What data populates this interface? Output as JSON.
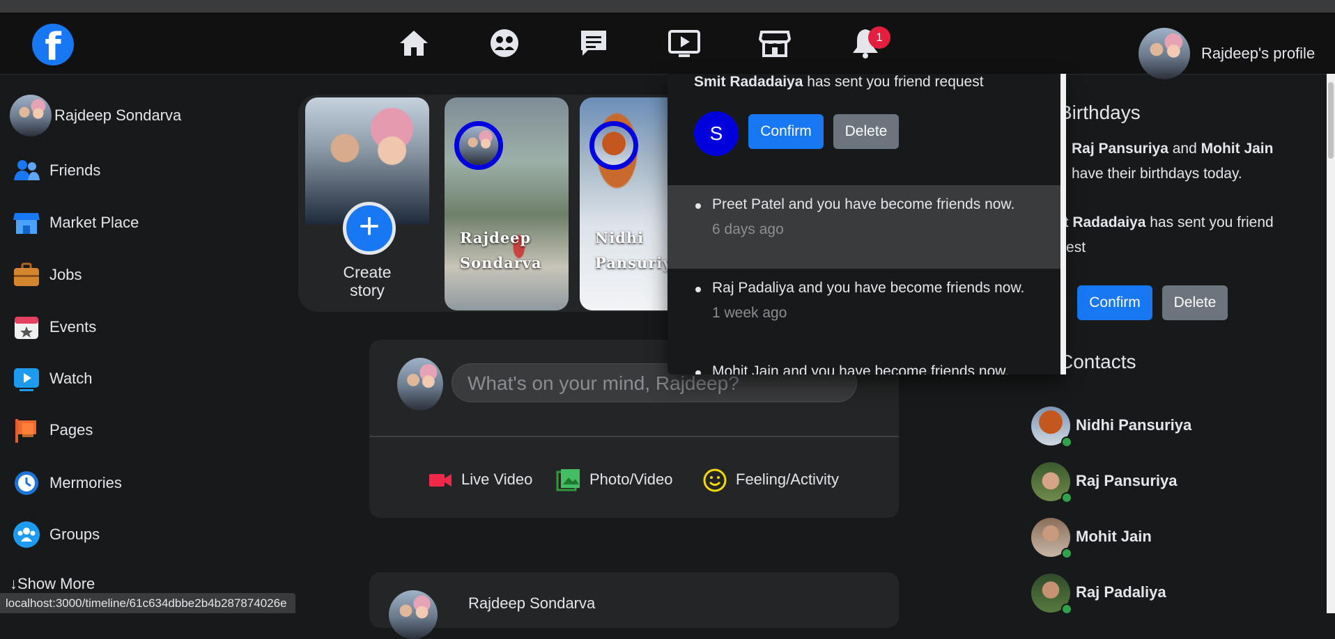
{
  "navbar": {
    "logo_letter": "f",
    "notification_count": "1",
    "profile_label": "Rajdeep's profile"
  },
  "sidebar": {
    "user_name": "Rajdeep Sondarva",
    "items": [
      {
        "label": "Friends",
        "icon": "friends-icon"
      },
      {
        "label": "Market Place",
        "icon": "marketplace-icon"
      },
      {
        "label": "Jobs",
        "icon": "briefcase-icon"
      },
      {
        "label": "Events",
        "icon": "calendar-icon"
      },
      {
        "label": "Watch",
        "icon": "play-icon"
      },
      {
        "label": "Pages",
        "icon": "flag-icon"
      },
      {
        "label": "Mermories",
        "icon": "clock-icon"
      },
      {
        "label": "Groups",
        "icon": "groups-icon"
      }
    ],
    "show_more": "Show More",
    "show_more_arrow": "↓"
  },
  "stories": {
    "create_label_1": "Create",
    "create_label_2": "story",
    "plus": "+",
    "items": [
      {
        "name_1": "Rajdeep",
        "name_2": "Sondarva"
      },
      {
        "name_1": "Nidhi",
        "name_2": "Pansuriya"
      }
    ]
  },
  "composer": {
    "placeholder": "What's on your mind, Rajdeep?",
    "actions": [
      "Live Video",
      "Photo/Video",
      "Feeling/Activity"
    ]
  },
  "post": {
    "author": "Rajdeep Sondarva"
  },
  "right": {
    "birthdays_title": "Birthdays",
    "birthday_name_1": "Raj Pansuriya",
    "birthday_and": "and",
    "birthday_name_2": "Mohit Jain",
    "birthday_suffix": "have their birthdays today.",
    "request_name": "Smit Radadaiya",
    "request_text_1": "has sent you friend",
    "request_text_2": "request",
    "confirm": "Confirm",
    "delete": "Delete",
    "contacts_title": "Contacts",
    "contacts": [
      "Nidhi Pansuriya",
      "Raj Pansuriya",
      "Mohit Jain",
      "Raj Padaliya"
    ]
  },
  "notifications": {
    "request_name": "Smit Radadaiya",
    "request_text": "has sent you friend request",
    "request_initial": "S",
    "confirm": "Confirm",
    "delete": "Delete",
    "items": [
      {
        "text": "Preet Patel and you have become friends now.",
        "time": "6 days ago"
      },
      {
        "text": "Raj Padaliya and you have become friends now.",
        "time": "1 week ago"
      },
      {
        "text": "Mohit Jain and you have become friends now.",
        "time": ""
      }
    ]
  },
  "status_bar": {
    "url": "localhost:3000/timeline/61c634dbbe2b4b287874026e"
  }
}
